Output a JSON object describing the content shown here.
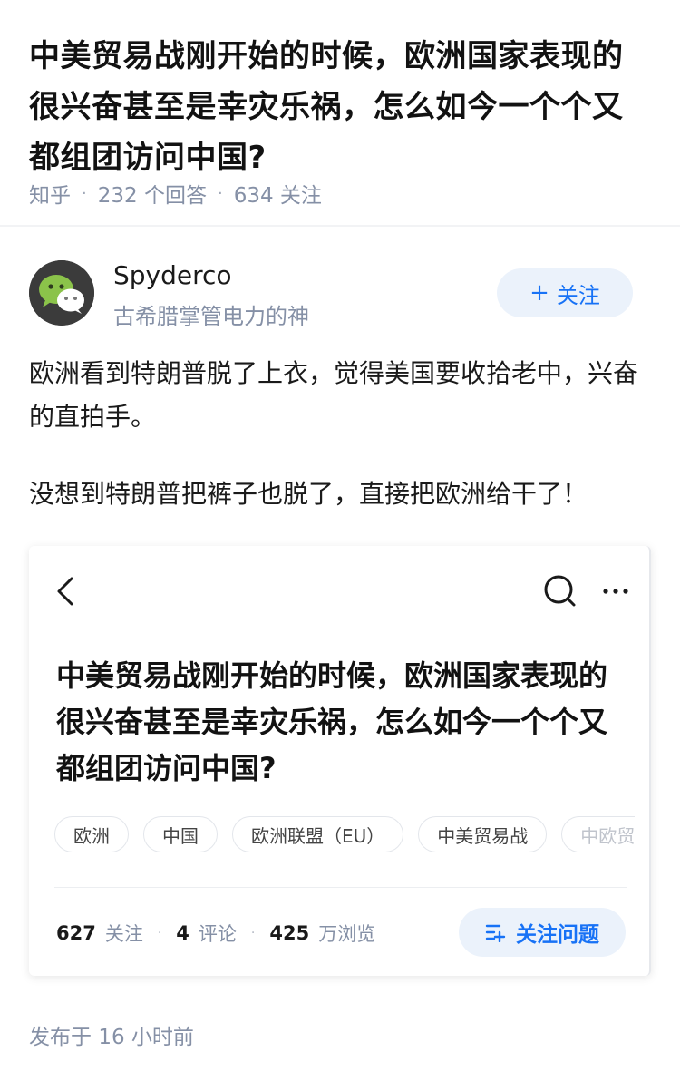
{
  "question": {
    "title": "中美贸易战刚开始的时候，欧洲国家表现的很兴奋甚至是幸灾乐祸，怎么如今一个个又都组团访问中国?",
    "source": "知乎",
    "answers_count": "232",
    "answers_label": "个回答",
    "follows_count": "634",
    "follows_label": "关注"
  },
  "author": {
    "name": "Spyderco",
    "subtitle": "古希腊掌管电力的神",
    "follow_label": "关注",
    "avatar_icon": "wechat-icon",
    "avatar_color": "#8bc34a"
  },
  "answer": {
    "paragraphs": [
      "欧洲看到特朗普脱了上衣，觉得美国要收拾老中，兴奋的直拍手。",
      "没想到特朗普把裤子也脱了，直接把欧洲给干了！"
    ]
  },
  "card": {
    "title": "中美贸易战刚开始的时候，欧洲国家表现的很兴奋甚至是幸灾乐祸，怎么如今一个个又都组团访问中国?",
    "tags": [
      "欧洲",
      "中国",
      "欧洲联盟（EU）",
      "中美贸易战",
      "中欧贸"
    ],
    "follows_count": "627",
    "follows_label": "关注",
    "comments_count": "4",
    "comments_label": "评论",
    "views_count": "425",
    "views_label": "万浏览",
    "follow_question_label": "关注问题",
    "accent_color": "#1772f6"
  },
  "footer": {
    "published_prefix": "发布于",
    "published_time": "16 小时前"
  }
}
